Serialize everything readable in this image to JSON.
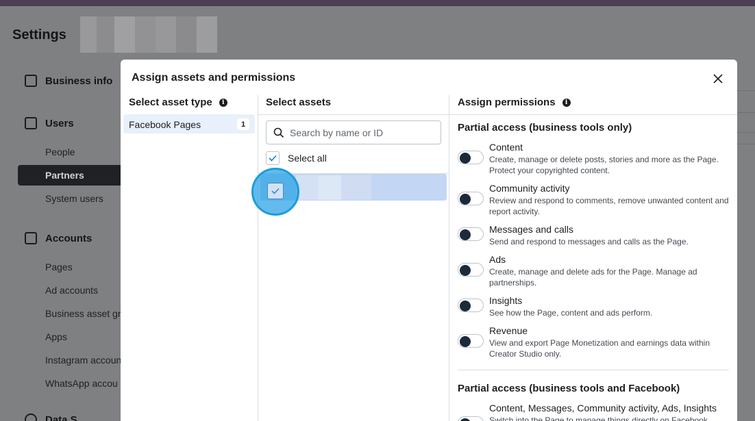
{
  "background": {
    "title": "Settings",
    "sections": [
      {
        "label": "Business info",
        "icon": "briefcase-icon"
      },
      {
        "label": "Users",
        "icon": "id-badge-icon"
      },
      {
        "label": "Accounts",
        "icon": "archive-icon"
      },
      {
        "label": "Data S",
        "icon": "people-icon"
      }
    ],
    "user_items": [
      "People",
      "Partners",
      "System users"
    ],
    "account_items": [
      "Pages",
      "Ad accounts",
      "Business asset gr",
      "Apps",
      "Instagram accoun",
      "WhatsApp accou"
    ],
    "active_item": "Partners"
  },
  "modal": {
    "title": "Assign assets and permissions",
    "close_icon": "close-icon",
    "columns": {
      "asset_type": "Select asset type",
      "assets": "Select assets",
      "permissions": "Assign permissions"
    },
    "asset_types": [
      {
        "label": "Facebook Pages",
        "count": "1"
      }
    ],
    "search": {
      "placeholder": "Search by name or ID",
      "value": ""
    },
    "select_all_label": "Select all",
    "permission_sections": [
      {
        "title": "Partial access (business tools only)",
        "items": [
          {
            "name": "Content",
            "desc": "Create, manage or delete posts, stories and more as the Page. Protect your copyrighted content."
          },
          {
            "name": "Community activity",
            "desc": "Review and respond to comments, remove unwanted content and report activity."
          },
          {
            "name": "Messages and calls",
            "desc": "Send and respond to messages and calls as the Page."
          },
          {
            "name": "Ads",
            "desc": "Create, manage and delete ads for the Page. Manage ad partnerships."
          },
          {
            "name": "Insights",
            "desc": "See how the Page, content and ads perform."
          },
          {
            "name": "Revenue",
            "desc": "View and export Page Monetization and earnings data within Creator Studio only."
          }
        ]
      },
      {
        "title": "Partial access (business tools and Facebook)",
        "items": [
          {
            "name": "Content, Messages, Community activity, Ads, Insights",
            "desc": "Switch into the Page to manage things directly on Facebook,"
          }
        ]
      }
    ]
  },
  "colors": {
    "accent": "#1b74e4",
    "highlight": "#2ea4e6",
    "selected_row": "#c3d7f4",
    "toggle_knob": "#1c2b3a"
  }
}
